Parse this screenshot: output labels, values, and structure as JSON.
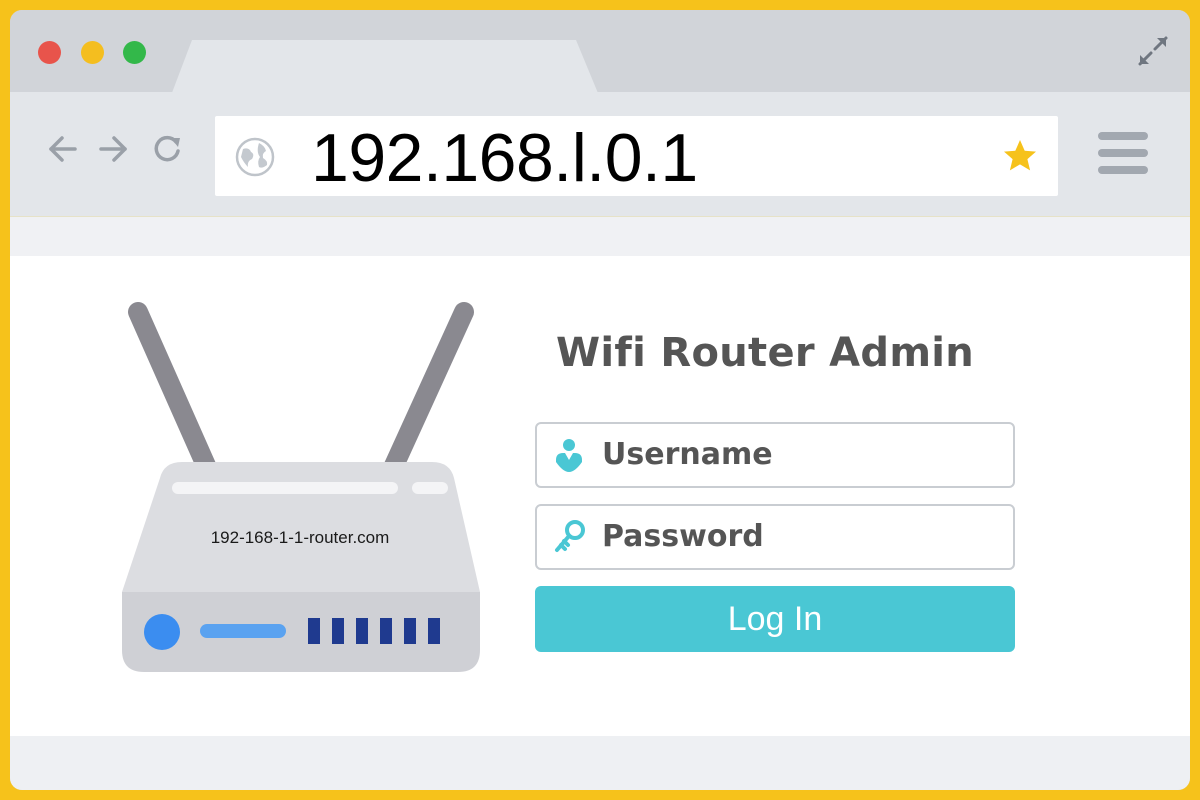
{
  "browser": {
    "address_bar": {
      "url": "192.168.l.0.1"
    },
    "icons": {
      "back": "arrow-left",
      "forward": "arrow-right",
      "reload": "reload",
      "site": "globe",
      "bookmark": "star",
      "menu": "hamburger",
      "expand": "expand-arrows"
    }
  },
  "router_illustration": {
    "label": "192-168-1-1-router.com"
  },
  "login": {
    "title": "Wifi Router Admin",
    "username_placeholder": "Username",
    "password_placeholder": "Password",
    "button_label": "Log In"
  },
  "colors": {
    "frame_border": "#f6c21b",
    "accent": "#4ac7d4",
    "star": "#f6c21b"
  }
}
